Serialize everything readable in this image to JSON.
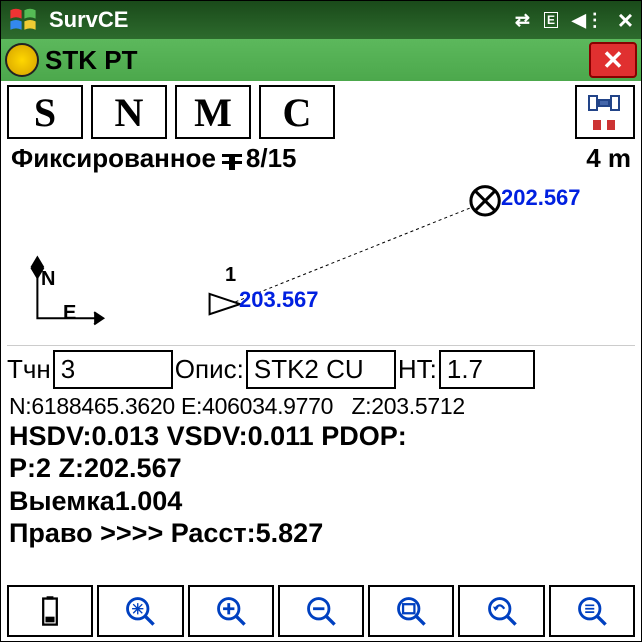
{
  "taskbar": {
    "title": "SurvCE"
  },
  "titlebar": {
    "title": "STK PT"
  },
  "toolbar": {
    "s": "S",
    "n": "N",
    "m": "M",
    "c": "C"
  },
  "status": {
    "fix": "Фиксированное",
    "sats": "8/15",
    "dist": "4 m"
  },
  "map": {
    "target_z": "202.567",
    "current_pt": "1",
    "current_z": "203.567",
    "n_label": "N",
    "e_label": "E"
  },
  "inputs": {
    "pt_label": "Тчн",
    "pt": "3",
    "desc_label": "Опис:",
    "desc": "STK2 CU",
    "ht_label": "HT:",
    "ht": "1.7"
  },
  "coords": {
    "n_lbl": "N:",
    "n": "6188465.3620",
    "e_lbl": "E:",
    "e": "406034.9770",
    "z_lbl": "Z:",
    "z": "203.5712"
  },
  "quality": "HSDV:0.013 VSDV:0.011 PDOP:",
  "pz": "P:2 Z:202.567",
  "cut": "Выемка1.004",
  "move": "Право >>>> Расст:5.827"
}
